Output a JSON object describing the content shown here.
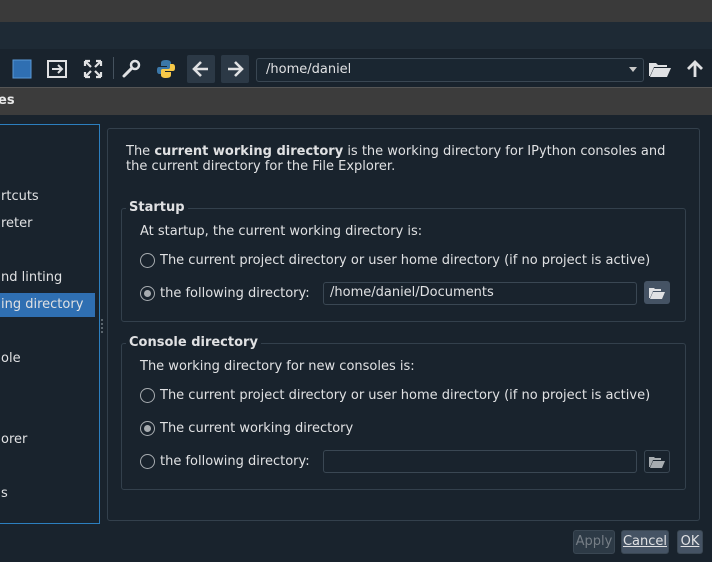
{
  "toolbar": {
    "path_value": "/home/daniel",
    "icons": [
      "stop-icon",
      "run-to-icon",
      "maximize-icon",
      "wrench-icon",
      "python-icon",
      "back-icon",
      "forward-icon",
      "folder-open-icon",
      "up-arrow-icon"
    ]
  },
  "dialog": {
    "title": "es"
  },
  "sidebar": {
    "items": [
      {
        "label": "rtcuts"
      },
      {
        "label": "reter"
      },
      {
        "label": "nd linting"
      },
      {
        "label": "ing directory",
        "selected": true
      },
      {
        "label": "ole"
      },
      {
        "label": "orer"
      },
      {
        "label": "s"
      }
    ]
  },
  "content": {
    "intro_pre": "The ",
    "intro_bold": "current working directory",
    "intro_post": " is the working directory for IPython consoles and the current directory for the File Explorer.",
    "startup": {
      "title": "Startup",
      "label": "At startup, the current working directory is:",
      "option1": "The current project directory or user home directory (if no project is active)",
      "option2": "the following directory:",
      "directory_value": "/home/daniel/Documents",
      "selected": "option2"
    },
    "console": {
      "title": "Console directory",
      "label": "The working directory for new consoles is:",
      "option1": "The current project directory or user home directory (if no project is active)",
      "option2": "The current working directory",
      "option3": "the following directory:",
      "directory_value": "",
      "selected": "option2"
    }
  },
  "buttons": {
    "apply": "Apply",
    "cancel": "Cancel",
    "ok": "OK"
  },
  "colors": {
    "background": "#19232d",
    "accent": "#2f6fb2",
    "button": "#455364"
  }
}
